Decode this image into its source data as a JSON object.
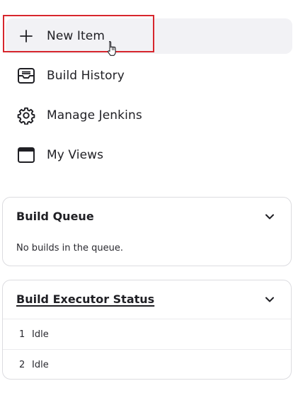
{
  "sidebar": {
    "tasks": [
      {
        "label": "New Item",
        "icon": "plus-icon"
      },
      {
        "label": "Build History",
        "icon": "inbox-tray-icon"
      },
      {
        "label": "Manage Jenkins",
        "icon": "gear-icon"
      },
      {
        "label": "My Views",
        "icon": "window-icon"
      }
    ]
  },
  "build_queue": {
    "title": "Build Queue",
    "empty_message": "No builds in the queue."
  },
  "executor_status": {
    "title": "Build Executor Status",
    "executors": [
      {
        "number": "1",
        "state": "Idle"
      },
      {
        "number": "2",
        "state": "Idle"
      }
    ]
  },
  "colors": {
    "highlight": "#d7262d",
    "hover_bg": "#f2f2f5",
    "text": "#1f1f24"
  }
}
